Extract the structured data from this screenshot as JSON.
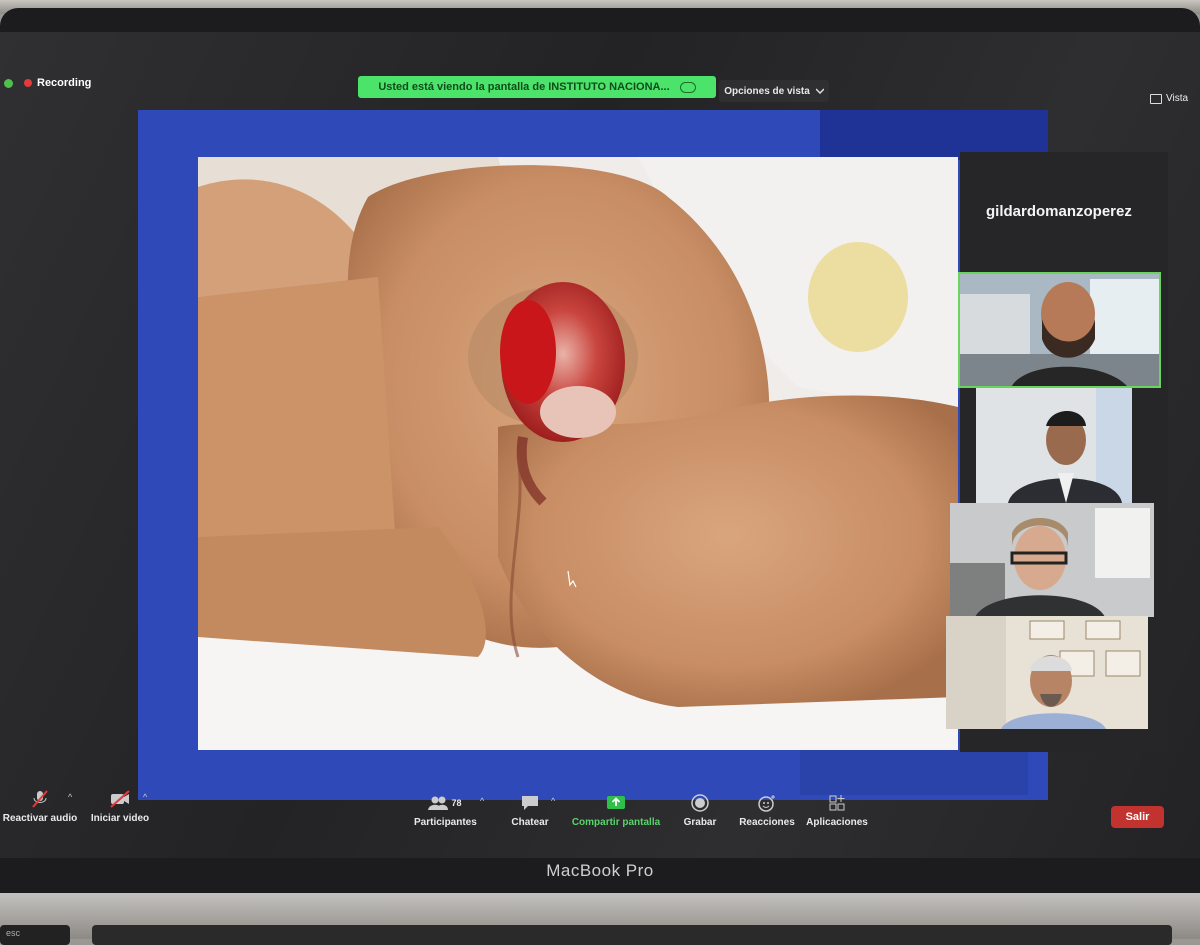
{
  "recording": {
    "label": "Recording"
  },
  "share_banner": {
    "text": "Usted está viendo la pantalla de INSTITUTO NACIONA..."
  },
  "view_options": {
    "label": "Opciones de vista"
  },
  "view_button": {
    "label": "Vista"
  },
  "active_speaker": {
    "name": "gildardomanzoperez"
  },
  "toolbar": {
    "audio_label": "Reactivar audio",
    "video_label": "Iniciar video",
    "participants_label": "Participantes",
    "participants_count": "78",
    "chat_label": "Chatear",
    "share_label": "Compartir pantalla",
    "record_label": "Grabar",
    "reactions_label": "Reacciones",
    "apps_label": "Aplicaciones",
    "leave_label": "Salir"
  },
  "device": {
    "label": "MacBook Pro",
    "esc_key": "esc"
  },
  "colors": {
    "share_green": "#4be36a",
    "leave_red": "#c2322f",
    "slide_blue": "#2f4ab8",
    "active_border": "#6ad45f"
  }
}
